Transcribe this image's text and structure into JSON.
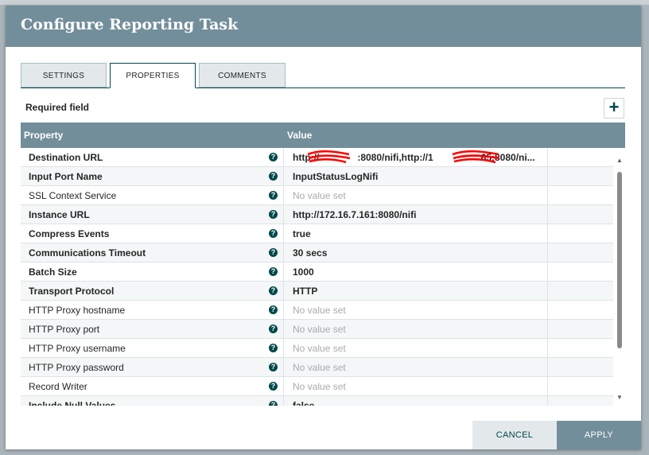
{
  "dialog": {
    "title": "Configure Reporting Task"
  },
  "tabs": [
    {
      "label": "SETTINGS"
    },
    {
      "label": "PROPERTIES",
      "active": true
    },
    {
      "label": "COMMENTS"
    }
  ],
  "required_field_label": "Required field",
  "add_button_label": "+",
  "table": {
    "headers": {
      "property": "Property",
      "value": "Value"
    },
    "help_glyph": "?",
    "rows": [
      {
        "name": "Destination URL",
        "value": "http://    :8080/nifi,http://1     65:8080/ni...",
        "required": true,
        "set": true
      },
      {
        "name": "Input Port Name",
        "value": "InputStatusLogNifi",
        "required": true,
        "set": true
      },
      {
        "name": "SSL Context Service",
        "value": "No value set",
        "required": false,
        "set": false
      },
      {
        "name": "Instance URL",
        "value": "http://172.16.7.161:8080/nifi",
        "required": true,
        "set": true
      },
      {
        "name": "Compress Events",
        "value": "true",
        "required": true,
        "set": true
      },
      {
        "name": "Communications Timeout",
        "value": "30 secs",
        "required": true,
        "set": true
      },
      {
        "name": "Batch Size",
        "value": "1000",
        "required": true,
        "set": true
      },
      {
        "name": "Transport Protocol",
        "value": "HTTP",
        "required": true,
        "set": true
      },
      {
        "name": "HTTP Proxy hostname",
        "value": "No value set",
        "required": false,
        "set": false
      },
      {
        "name": "HTTP Proxy port",
        "value": "No value set",
        "required": false,
        "set": false
      },
      {
        "name": "HTTP Proxy username",
        "value": "No value set",
        "required": false,
        "set": false
      },
      {
        "name": "HTTP Proxy password",
        "value": "No value set",
        "required": false,
        "set": false
      },
      {
        "name": "Record Writer",
        "value": "No value set",
        "required": false,
        "set": false
      },
      {
        "name": "Include Null Values",
        "value": "false",
        "required": true,
        "set": true
      }
    ]
  },
  "buttons": {
    "cancel": "CANCEL",
    "apply": "APPLY"
  },
  "colors": {
    "header": "#728e9b",
    "accent": "#004849",
    "redaction": "#ff0000"
  }
}
